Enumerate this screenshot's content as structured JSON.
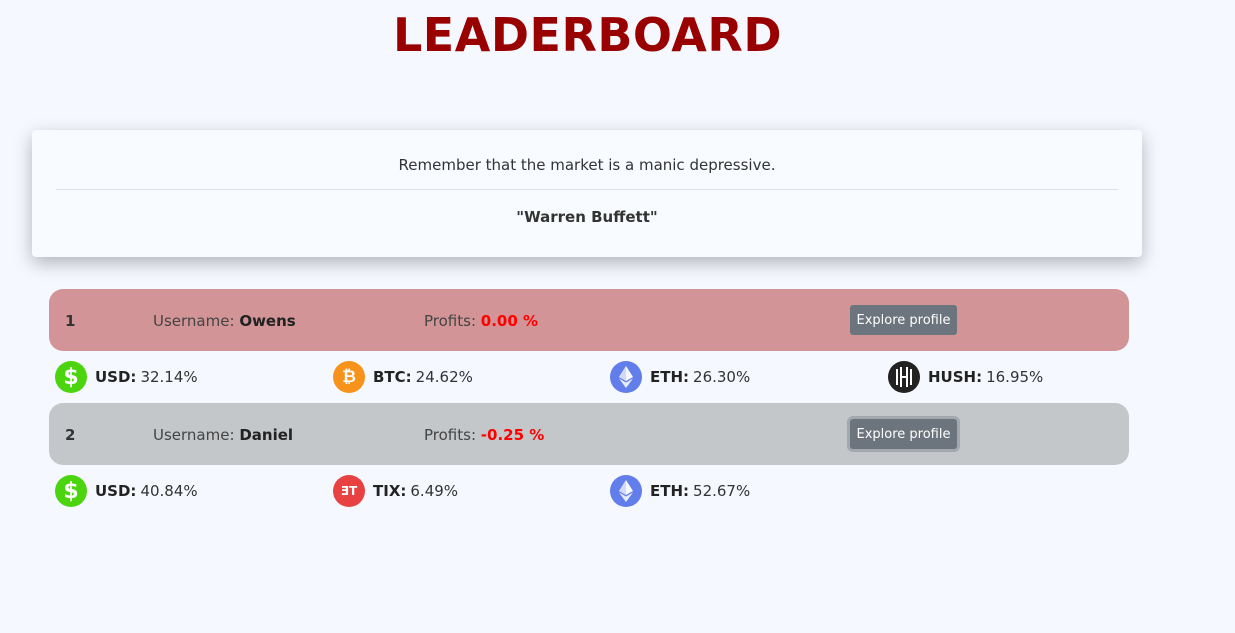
{
  "page": {
    "title": "LEADERBOARD"
  },
  "quote": {
    "text": "Remember that the market is a manic depressive.",
    "author": "\"Warren Buffett\""
  },
  "entries": [
    {
      "rank": "1",
      "username_label": "Username:",
      "username": "Owens",
      "profits_label": "Profits:",
      "profits": "0.00 %",
      "button": "Explore profile",
      "row_color": "#d29496",
      "assets": [
        {
          "symbol": "USD:",
          "percent": "32.14%",
          "icon": "dollar-icon"
        },
        {
          "symbol": "BTC:",
          "percent": "24.62%",
          "icon": "bitcoin-icon"
        },
        {
          "symbol": "ETH:",
          "percent": "26.30%",
          "icon": "ethereum-icon"
        },
        {
          "symbol": "HUSH:",
          "percent": "16.95%",
          "icon": "hush-icon"
        }
      ]
    },
    {
      "rank": "2",
      "username_label": "Username:",
      "username": "Daniel",
      "profits_label": "Profits:",
      "profits": "-0.25 %",
      "button": "Explore profile",
      "row_color": "#c3c7ca",
      "assets": [
        {
          "symbol": "USD:",
          "percent": "40.84%",
          "icon": "dollar-icon"
        },
        {
          "symbol": "TIX:",
          "percent": "6.49%",
          "icon": "tix-icon"
        },
        {
          "symbol": "ETH:",
          "percent": "52.67%",
          "icon": "ethereum-icon"
        }
      ]
    }
  ],
  "colors": {
    "title": "#990000",
    "profit_value": "#ff0000",
    "button": "#6c757d",
    "usd": "#4cd40f",
    "btc": "#f7931a",
    "eth": "#627eea",
    "hush": "#222222",
    "tix": "#e84142"
  }
}
